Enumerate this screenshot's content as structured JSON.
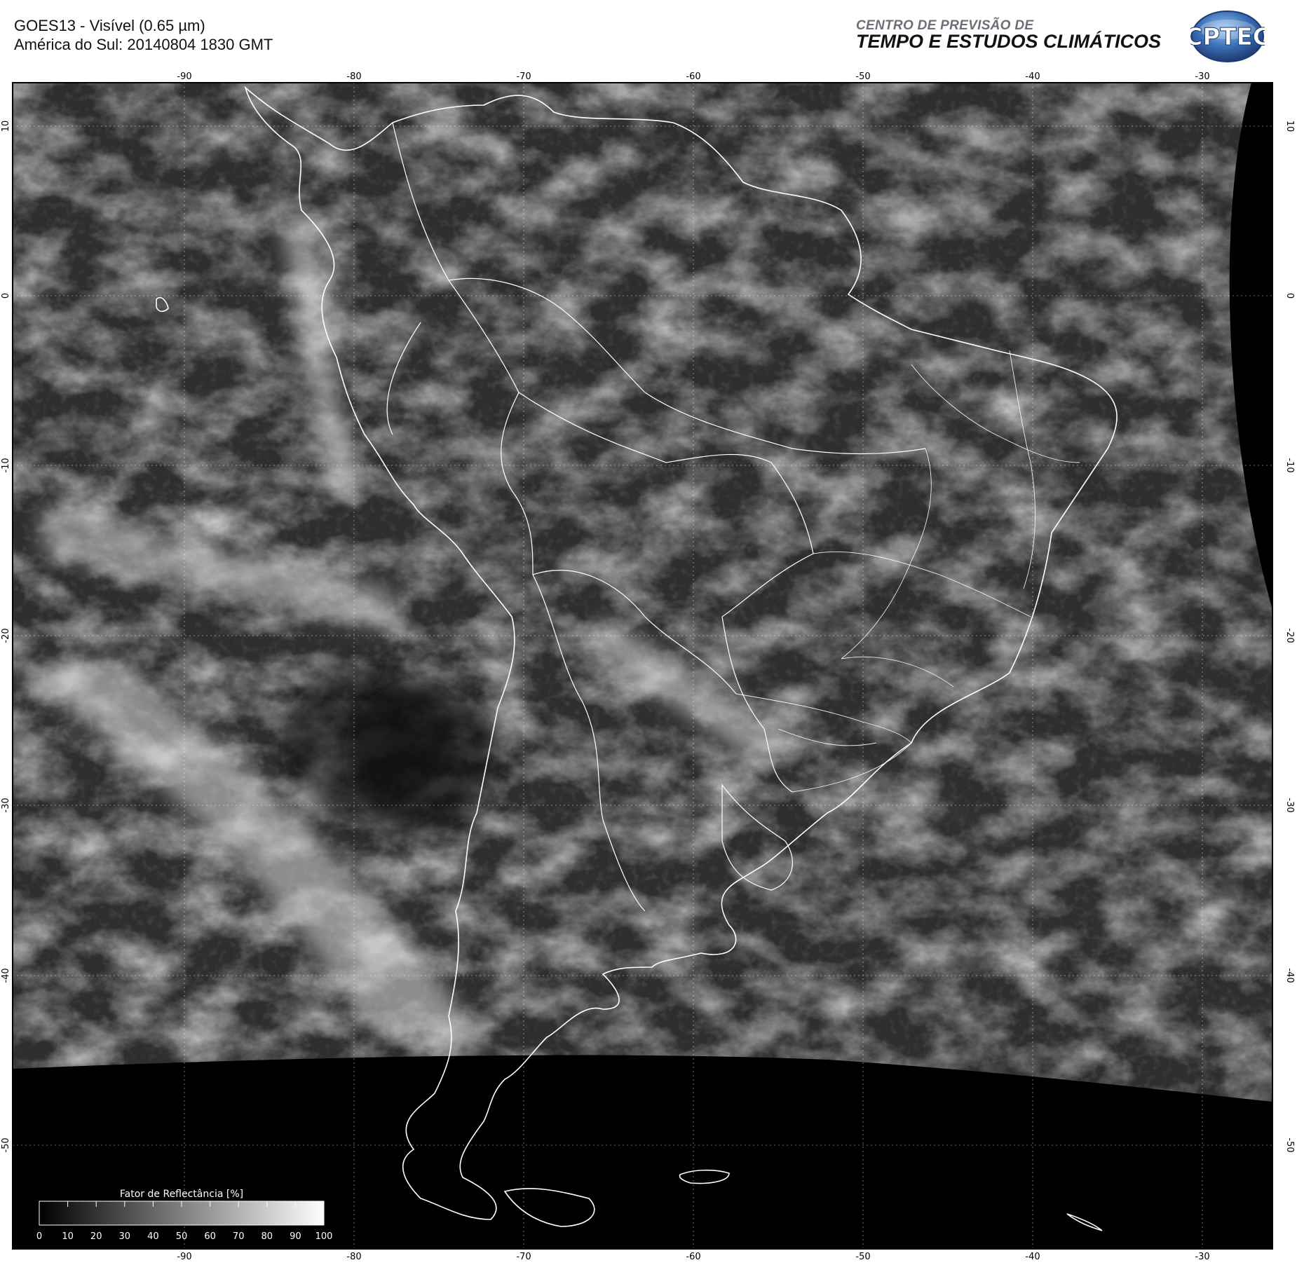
{
  "header": {
    "title_line1": "GOES13 - Visível (0.65 µm)",
    "title_line2": "América do Sul: 20140804 1830 GMT",
    "org_line1": "CENTRO DE PREVISÃO DE",
    "org_line2": "TEMPO E ESTUDOS CLIMÁTICOS",
    "logo_text": "CPTEC"
  },
  "map": {
    "longitude_labels": [
      "-90",
      "-80",
      "-70",
      "-60",
      "-50",
      "-40",
      "-30"
    ],
    "latitude_labels": [
      "10",
      "0",
      "-10",
      "-20",
      "-30",
      "-40",
      "-50"
    ]
  },
  "colorbar": {
    "title": "Fator de Reflectância [%]",
    "ticks": [
      "0",
      "10",
      "20",
      "30",
      "40",
      "50",
      "60",
      "70",
      "80",
      "90",
      "100"
    ]
  },
  "colors": {
    "background": "#ffffff",
    "space": "#000000",
    "cloud": "#d8d8d8",
    "coastline": "#ffffff",
    "logo_blue": "#2f5fa6"
  }
}
